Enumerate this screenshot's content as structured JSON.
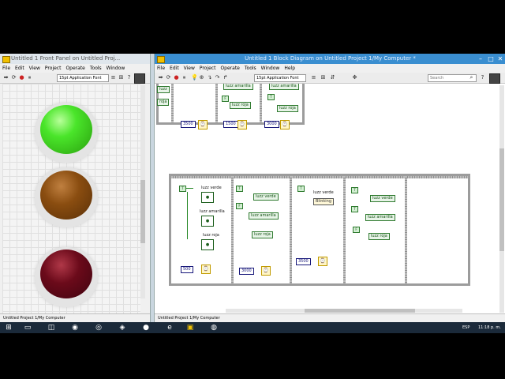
{
  "front_panel": {
    "title": "Untitled 1 Front Panel on Untitled Proj...",
    "menus": [
      "File",
      "Edit",
      "View",
      "Project",
      "Operate",
      "Tools",
      "Window"
    ],
    "font_selector": "15pt Application Font",
    "status_bar": "Untitled Project 1/My Computer",
    "leds": [
      {
        "name": "green",
        "color": "#4ae52a"
      },
      {
        "name": "amber",
        "color": "#8a4d10"
      },
      {
        "name": "red",
        "color": "#6b0a1a"
      }
    ]
  },
  "block_diagram": {
    "title": "Untitled 1 Block Diagram on Untitled Project 1/My Computer *",
    "menus": [
      "File",
      "Edit",
      "View",
      "Project",
      "Operate",
      "Tools",
      "Window",
      "Help"
    ],
    "font_selector": "15pt Application Font",
    "search_placeholder": "Search",
    "status_bar": "Untitled Project 1/My Computer",
    "top_frame": {
      "c1": "3500",
      "c2": "1500",
      "c3": "3000",
      "lbl_a": "luzz amarilla",
      "lbl_r": "luzz roja",
      "lbl_r2": "luzz roja",
      "lbl_am2": "luzz amarilla"
    },
    "bottom_frame": {
      "f1": {
        "luz_verde": "luzz verde",
        "luz_amarilla": "luzz amarilla",
        "luz_roja": "luzz roja",
        "wait": "500"
      },
      "f2": {
        "luz_verde": "luzz verde",
        "luz_amarilla": "luzz amarilla",
        "luz_roja": "luzz roja",
        "wait": "3000"
      },
      "f3": {
        "luz_verde": "luzz verde",
        "blinking": "Blinking",
        "wait": "3500"
      },
      "f4": {
        "luz_verde": "luzz verde",
        "luz_amarilla": "luzz amarilla",
        "luz_roja": "luzz roja"
      }
    }
  },
  "taskbar": {
    "language": "ESP",
    "time": "11:18 p. m."
  }
}
